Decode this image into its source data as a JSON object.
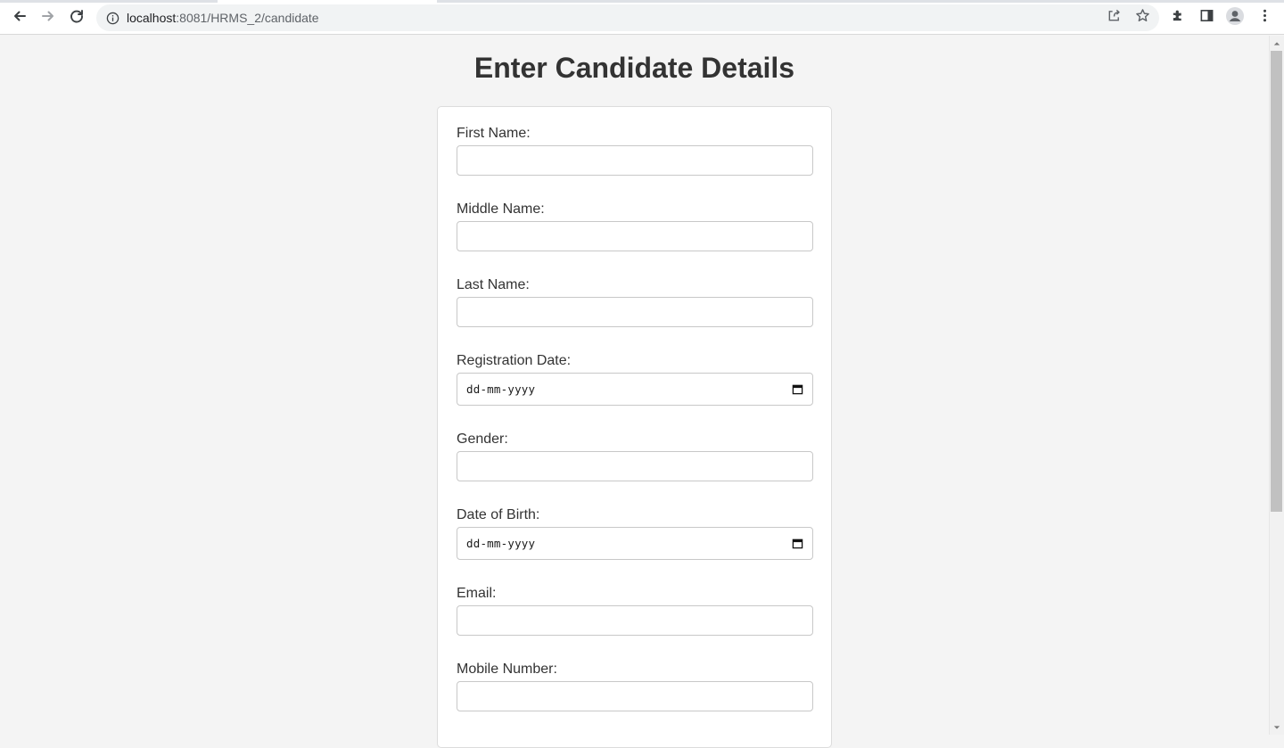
{
  "browser": {
    "url_host": "localhost",
    "url_path": ":8081/HRMS_2/candidate",
    "icons": [
      "back-icon",
      "forward-icon",
      "reload-icon",
      "info-icon",
      "share-icon",
      "star-icon",
      "extensions-icon",
      "side-panel-icon",
      "profile-icon",
      "menu-icon"
    ]
  },
  "page": {
    "title": "Enter Candidate Details"
  },
  "form": {
    "fields": [
      {
        "label": "First Name:",
        "type": "text",
        "value": ""
      },
      {
        "label": "Middle Name:",
        "type": "text",
        "value": ""
      },
      {
        "label": "Last Name:",
        "type": "text",
        "value": ""
      },
      {
        "label": "Registration Date:",
        "type": "date",
        "placeholder": "dd-mm-yyyy"
      },
      {
        "label": "Gender:",
        "type": "text",
        "value": ""
      },
      {
        "label": "Date of Birth:",
        "type": "date",
        "placeholder": "dd-mm-yyyy"
      },
      {
        "label": "Email:",
        "type": "text",
        "value": ""
      },
      {
        "label": "Mobile Number:",
        "type": "text",
        "value": ""
      }
    ]
  },
  "colors": {
    "page_bg": "#f4f4f4",
    "card_bg": "#ffffff",
    "title_text": "#333333",
    "input_border": "#c8c8c8"
  }
}
